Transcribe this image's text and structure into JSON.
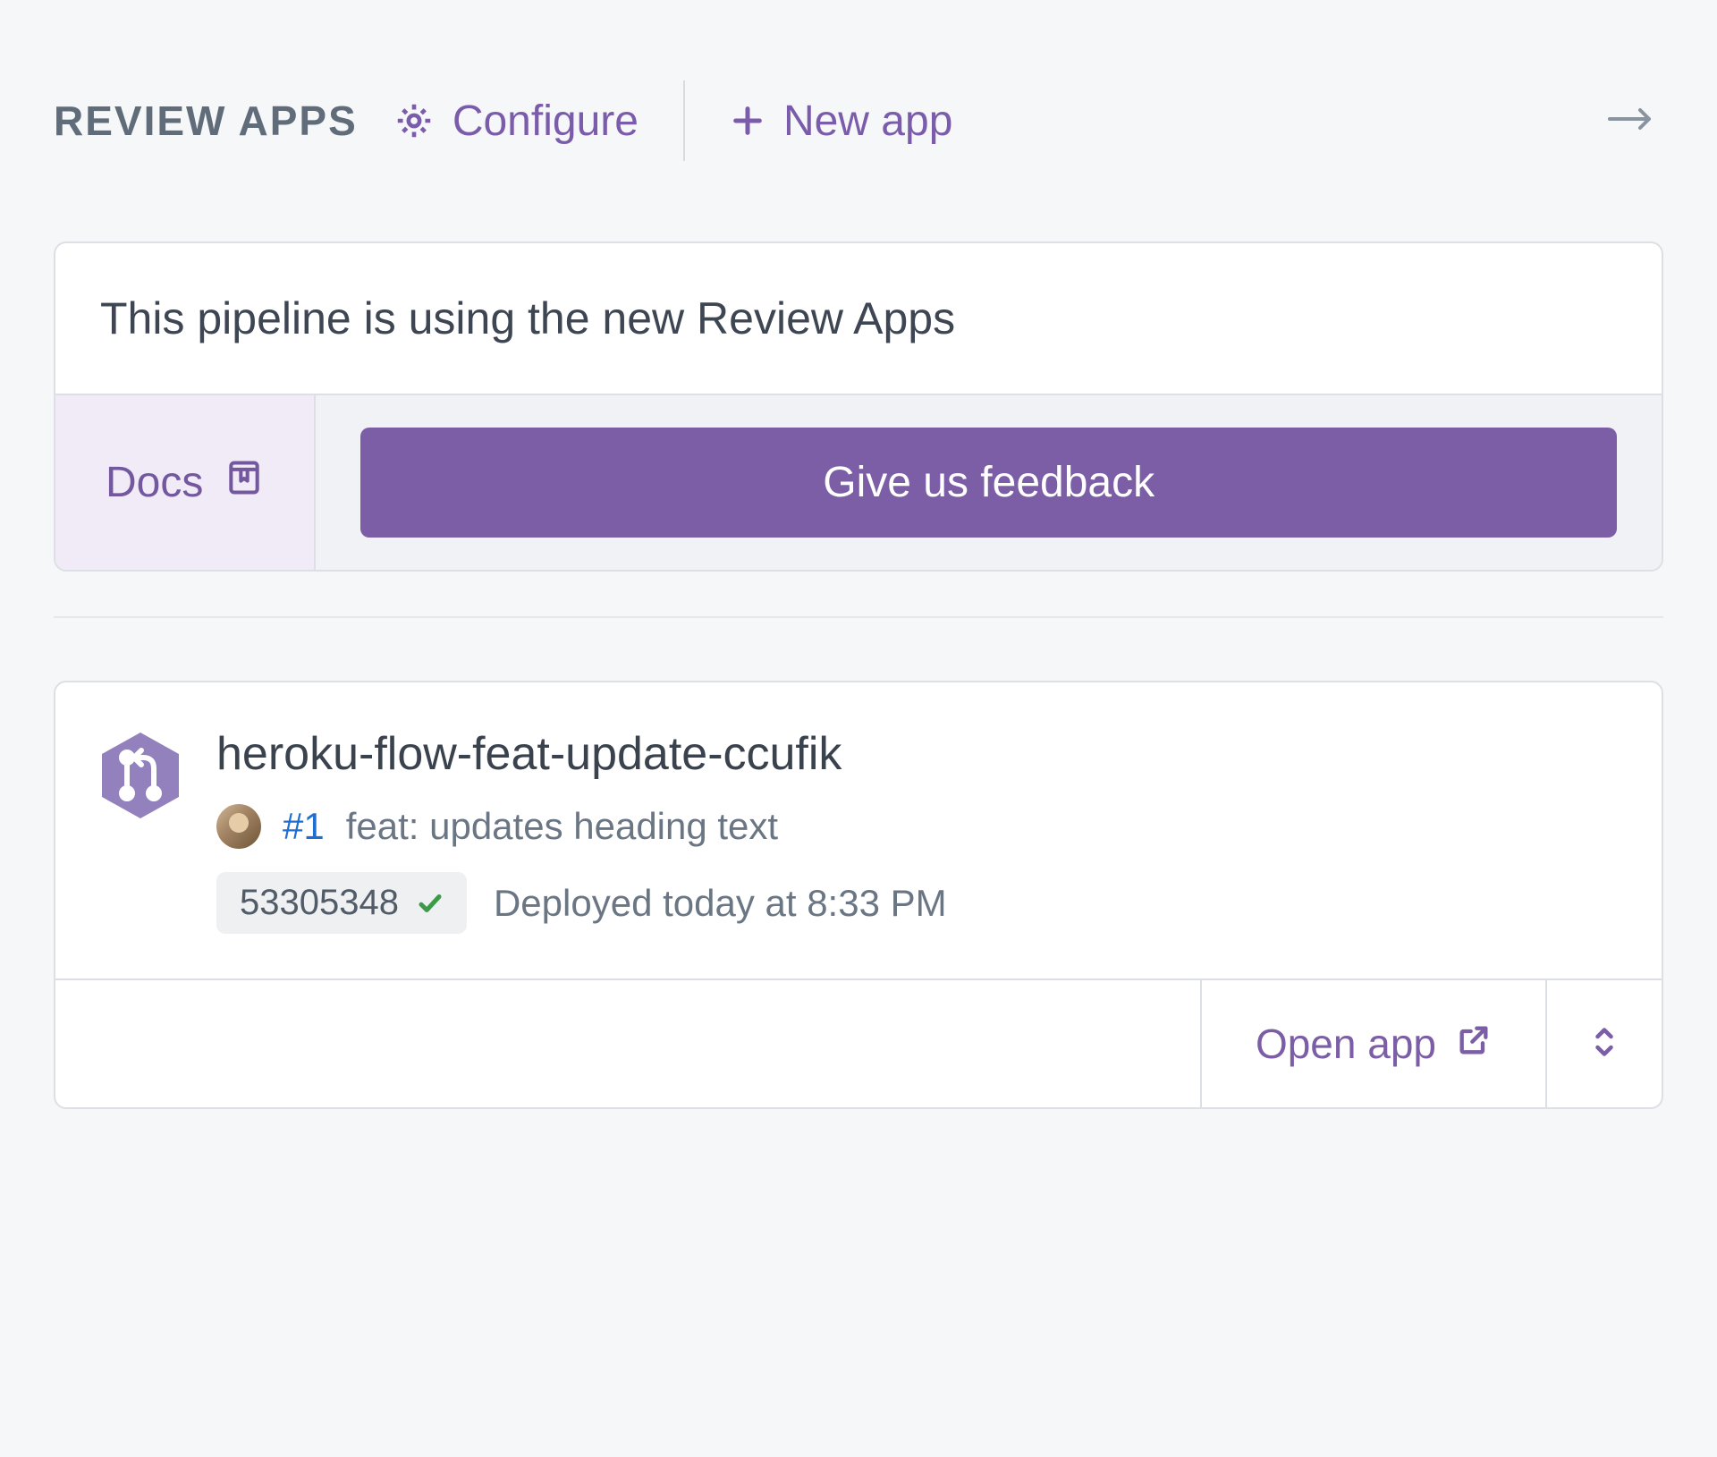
{
  "header": {
    "title": "REVIEW APPS",
    "configure_label": "Configure",
    "new_app_label": "New app"
  },
  "banner": {
    "message": "This pipeline is using the new Review Apps",
    "docs_label": "Docs",
    "feedback_label": "Give us feedback"
  },
  "app": {
    "name": "heroku-flow-feat-update-ccufik",
    "pr": {
      "number_label": "#1",
      "description": "feat: updates heading text"
    },
    "commit": "53305348",
    "deploy_status": "Deployed today at 8:33 PM",
    "open_label": "Open app"
  }
}
